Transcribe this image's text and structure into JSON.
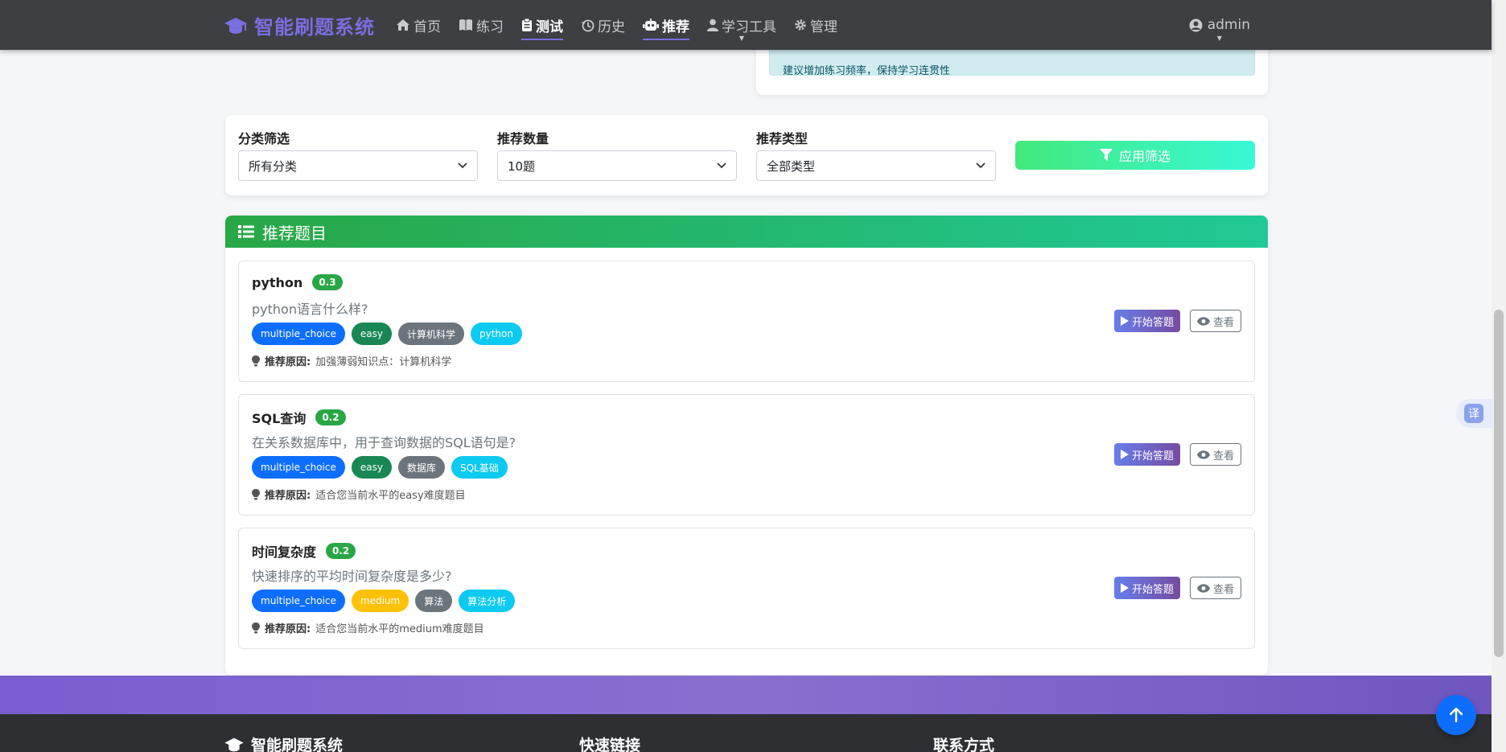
{
  "nav": {
    "brand": "智能刷题系统",
    "items": [
      {
        "label": "首页",
        "icon": "home-icon"
      },
      {
        "label": "练习",
        "icon": "book-icon"
      },
      {
        "label": "测试",
        "icon": "clipboard-icon",
        "active": true
      },
      {
        "label": "历史",
        "icon": "history-icon"
      },
      {
        "label": "推荐",
        "icon": "robot-icon",
        "active": true
      },
      {
        "label": "学习工具",
        "icon": "user-icon",
        "dropdown": true
      },
      {
        "label": "管理",
        "icon": "gear-icon"
      }
    ],
    "user": "admin"
  },
  "stats": {
    "alert_text": "建议增加练习频率，保持学习连贯性"
  },
  "filters": {
    "category_label": "分类筛选",
    "category_value": "所有分类",
    "count_label": "推荐数量",
    "count_value": "10题",
    "type_label": "推荐类型",
    "type_value": "全部类型",
    "apply_label": "应用筛选"
  },
  "recommend": {
    "header": "推荐题目",
    "reason_label": "推荐原因:",
    "start_label": "开始答题",
    "view_label": "查看",
    "questions": [
      {
        "title": "python",
        "score": "0.3",
        "desc": "python语言什么样?",
        "tags": [
          "multiple_choice",
          "easy",
          "计算机科学",
          "python"
        ],
        "reason": "加强薄弱知识点：计算机科学"
      },
      {
        "title": "SQL查询",
        "score": "0.2",
        "desc": "在关系数据库中，用于查询数据的SQL语句是?",
        "tags": [
          "multiple_choice",
          "easy",
          "数据库",
          "SQL基础"
        ],
        "reason": "适合您当前水平的easy难度题目"
      },
      {
        "title": "时间复杂度",
        "score": "0.2",
        "desc": "快速排序的平均时间复杂度是多少?",
        "tags": [
          "multiple_choice",
          "medium",
          "算法",
          "算法分析"
        ],
        "reason": "适合您当前水平的medium难度题目"
      }
    ]
  },
  "footer": {
    "brand": "智能刷题系统",
    "links_title": "快速链接",
    "contact_title": "联系方式"
  },
  "floating": {
    "translate": "译"
  },
  "colors": {
    "navbar": "#3d3f43",
    "brand": "#7a6ee0",
    "header_gradient_start": "#28a745",
    "header_gradient_end": "#20c997"
  }
}
